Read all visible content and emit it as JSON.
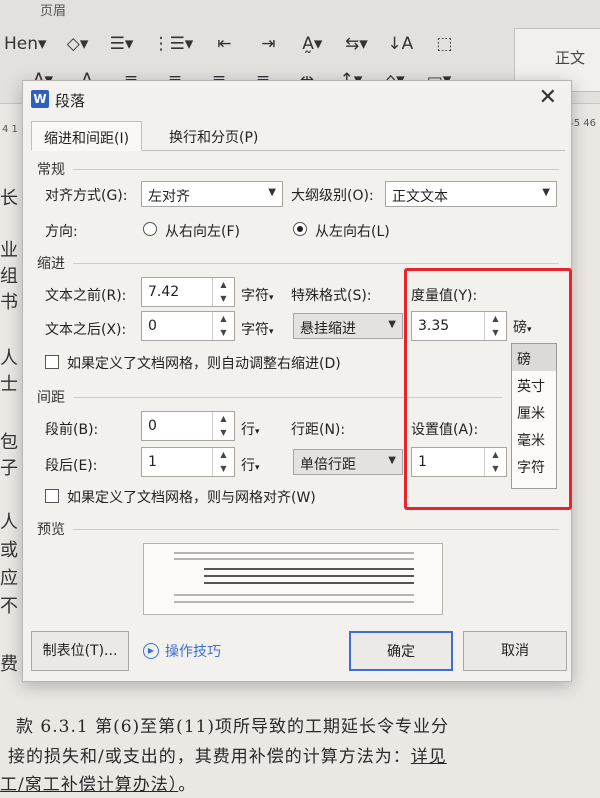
{
  "toolbar": {
    "top_label": "页眉",
    "style_name": "正文",
    "row1": [
      "Hen▾",
      "◇▾",
      "☰▾",
      "⋮☰▾",
      "⇤",
      "⇥",
      "A̰▾",
      "⇆▾",
      "↓A",
      "⬚"
    ],
    "row2": [
      "A▾",
      "A",
      "≡",
      "≡",
      "≡",
      "≡",
      "⇹",
      "↕▾",
      "⌂▾",
      "▭▾"
    ],
    "ruler_right": "45 46",
    "ruler_left": "4 1"
  },
  "document": {
    "edge_chars": [
      "长",
      "业",
      "组",
      "书",
      "人",
      "士",
      "包",
      "子",
      "人",
      "或",
      "应",
      "不",
      "费"
    ],
    "lines": [
      {
        "text": "款 6.3.1 第(6)至第(11)项所导致的工期延长令专业分"
      },
      {
        "text": "接的损失和/或支出的，其费用补偿的计算方法为：",
        "link": "详见"
      },
      {
        "text": "工/窝工补偿计算办法）",
        "suffix": "。"
      }
    ]
  },
  "dialog": {
    "app_icon": "W",
    "title": "段落",
    "close": "✕",
    "tabs": [
      "缩进和间距(I)",
      "换行和分页(P)"
    ],
    "general": {
      "section": "常规",
      "alignment_label": "对齐方式(G):",
      "alignment_value": "左对齐",
      "outline_label": "大纲级别(O):",
      "outline_value": "正文文本",
      "direction_label": "方向:",
      "rtl_label": "从右向左(F)",
      "ltr_label": "从左向右(L)"
    },
    "indent": {
      "section": "缩进",
      "before_label": "文本之前(R):",
      "before_value": "7.42",
      "before_unit": "字符",
      "after_label": "文本之后(X):",
      "after_value": "0",
      "after_unit": "字符",
      "special_label": "特殊格式(S):",
      "special_value": "悬挂缩进",
      "measure_label": "度量值(Y):",
      "measure_value": "3.35",
      "measure_unit": "磅",
      "grid_check_label": "如果定义了文档网格，则自动调整右缩进(D)"
    },
    "unit_options": [
      "磅",
      "英寸",
      "厘米",
      "毫米",
      "字符"
    ],
    "spacing": {
      "section": "间距",
      "before_label": "段前(B):",
      "before_value": "0",
      "before_unit": "行",
      "after_label": "段后(E):",
      "after_value": "1",
      "after_unit": "行",
      "line_label": "行距(N):",
      "line_value": "单倍行距",
      "set_label": "设置值(A):",
      "set_value": "1",
      "grid_check_label": "如果定义了文档网格，则与网格对齐(W)"
    },
    "preview": {
      "section": "预览"
    },
    "buttons": {
      "tabs_button": "制表位(T)...",
      "tips_link": "操作技巧",
      "ok": "确定",
      "cancel": "取消"
    }
  },
  "colors": {
    "highlight_red": "#e8232b",
    "accent_blue": "#3b6fd4"
  }
}
